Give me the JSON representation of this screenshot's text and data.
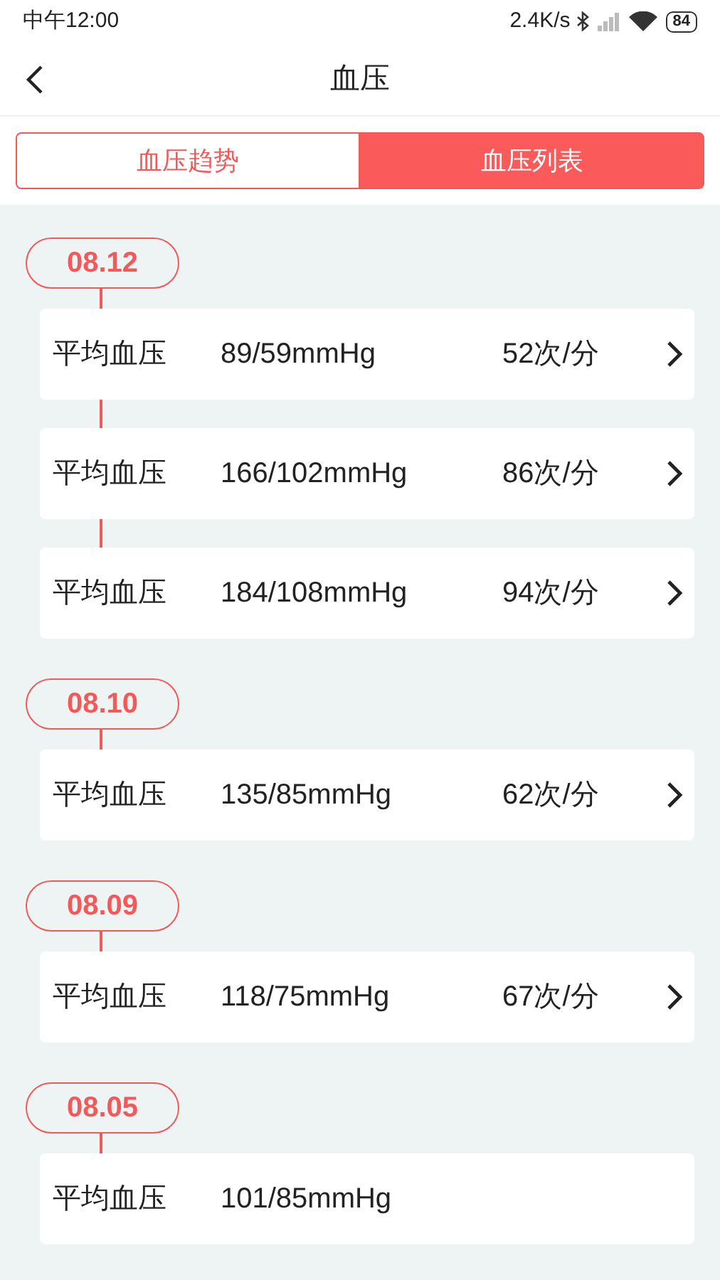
{
  "status_bar": {
    "time": "中午12:00",
    "speed": "2.4K/s",
    "battery": "84"
  },
  "header": {
    "title": "血压"
  },
  "tabs": [
    {
      "label": "血压趋势",
      "selected": false
    },
    {
      "label": "血压列表",
      "selected": true
    }
  ],
  "groups": [
    {
      "date": "08.12",
      "records": [
        {
          "label": "平均血压",
          "pressure": "89/59mmHg",
          "pulse": "52次/分"
        },
        {
          "label": "平均血压",
          "pressure": "166/102mmHg",
          "pulse": "86次/分"
        },
        {
          "label": "平均血压",
          "pressure": "184/108mmHg",
          "pulse": "94次/分"
        }
      ]
    },
    {
      "date": "08.10",
      "records": [
        {
          "label": "平均血压",
          "pressure": "135/85mmHg",
          "pulse": "62次/分"
        }
      ]
    },
    {
      "date": "08.09",
      "records": [
        {
          "label": "平均血压",
          "pressure": "118/75mmHg",
          "pulse": "67次/分"
        }
      ]
    },
    {
      "date": "08.05",
      "records": [
        {
          "label": "平均血压",
          "pressure": "101/85mmHg"
        }
      ]
    }
  ]
}
